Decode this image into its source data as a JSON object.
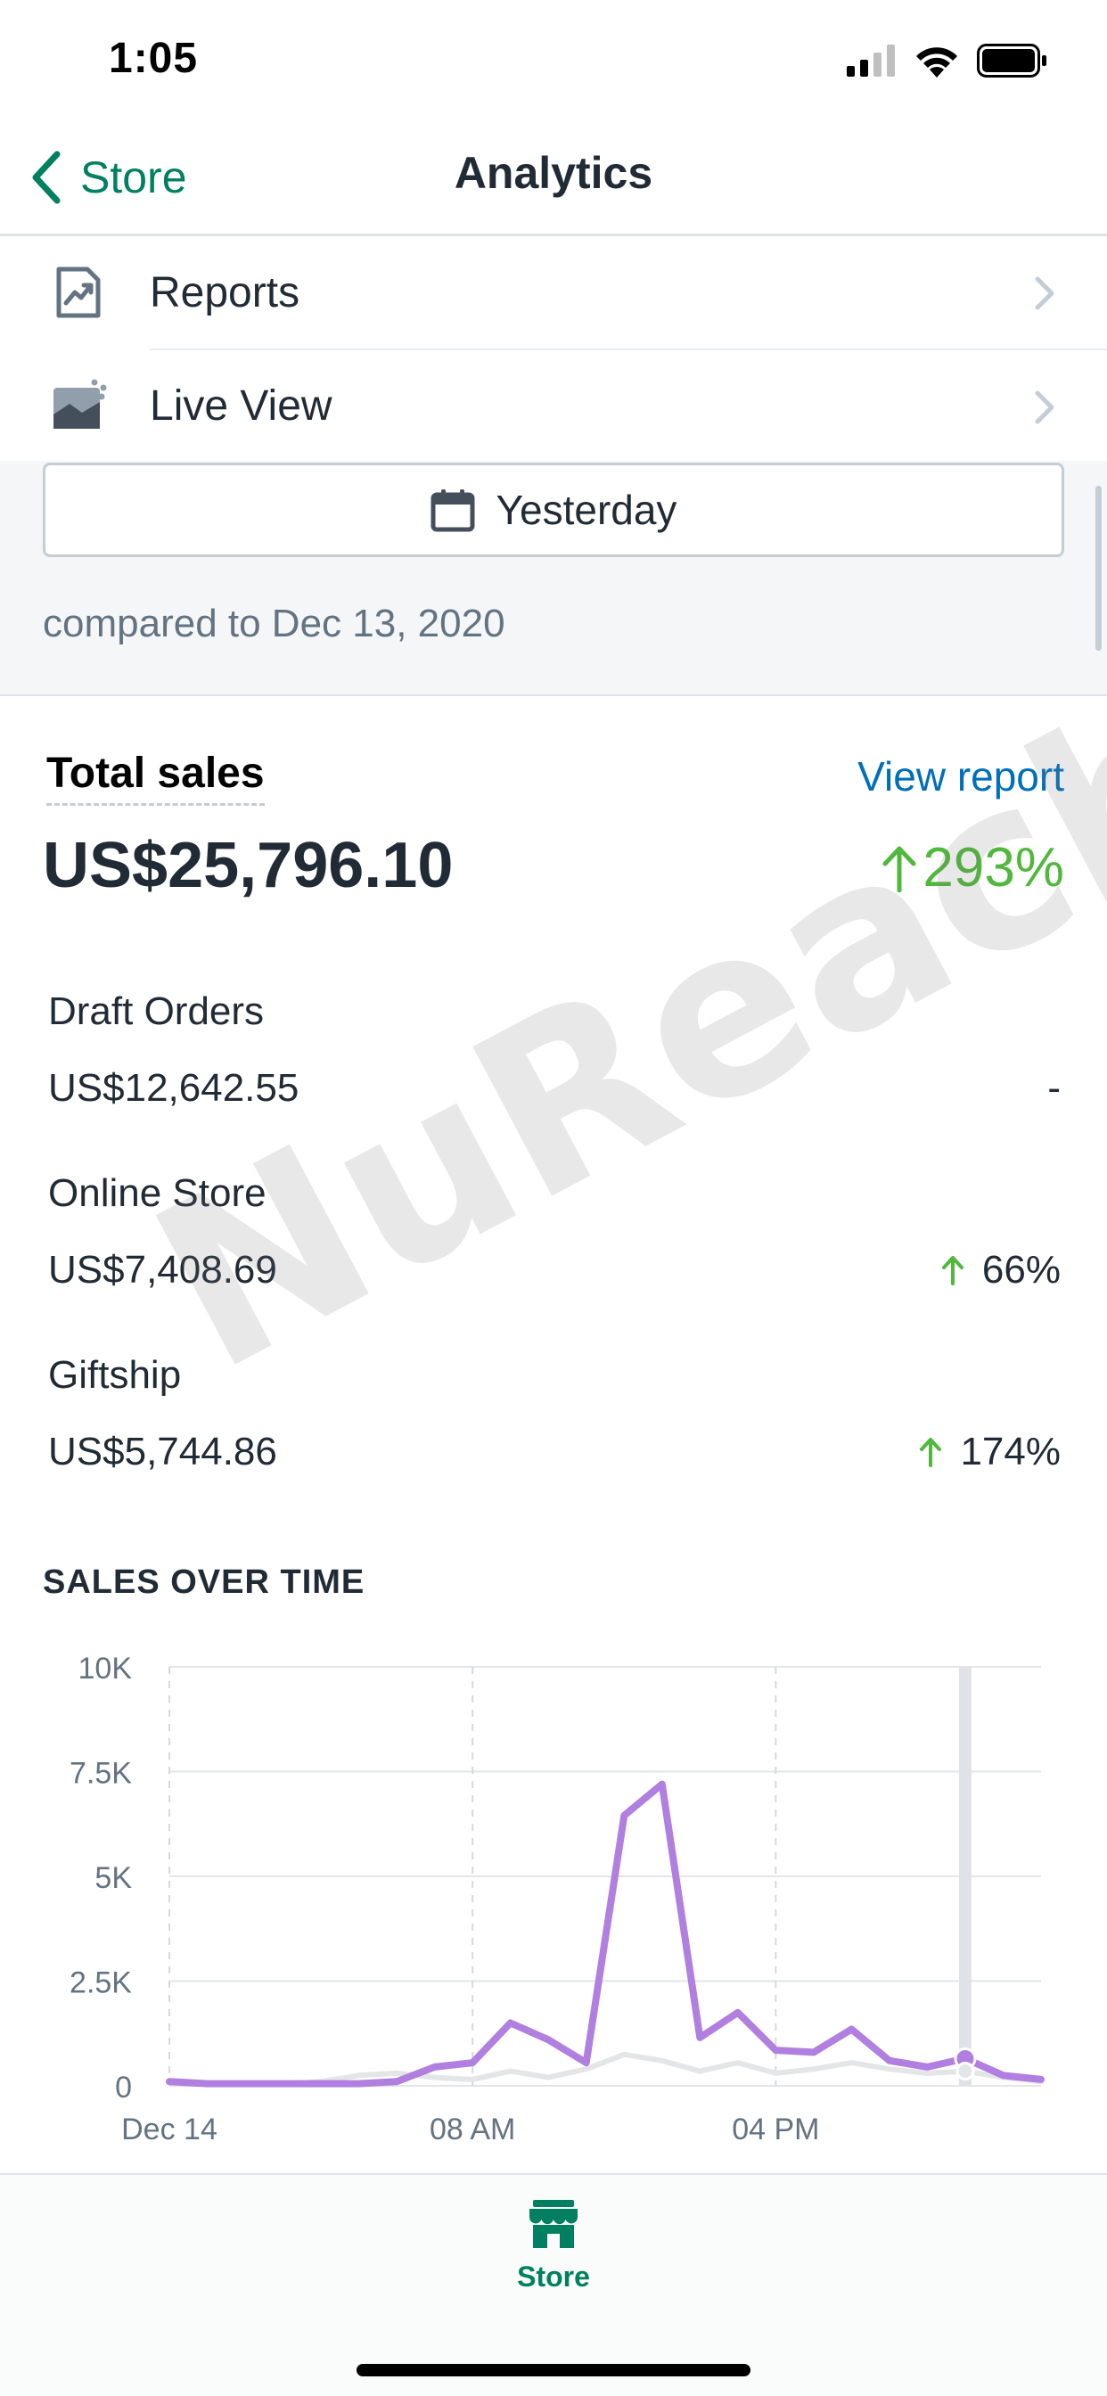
{
  "status_bar": {
    "time": "1:05"
  },
  "nav": {
    "back_label": "Store",
    "title": "Analytics"
  },
  "menu": [
    {
      "label": "Reports",
      "icon": "reports-icon"
    },
    {
      "label": "Live View",
      "icon": "live-view-icon"
    }
  ],
  "date_range": {
    "label": "Yesterday",
    "compare": "compared to Dec 13, 2020"
  },
  "total_sales": {
    "label": "Total sales",
    "view_report": "View report",
    "value": "US$25,796.10",
    "change": "293%"
  },
  "channels": [
    {
      "name": "Draft Orders",
      "value": "US$12,642.55",
      "change": "-",
      "trend": "none"
    },
    {
      "name": "Online Store",
      "value": "US$7,408.69",
      "change": "66%",
      "trend": "up"
    },
    {
      "name": "Giftship",
      "value": "US$5,744.86",
      "change": "174%",
      "trend": "up"
    }
  ],
  "watermark": "NuReach",
  "chart_heading": "SALES OVER TIME",
  "chart_data": {
    "type": "line",
    "title": "SALES OVER TIME",
    "xlabel": "",
    "ylabel": "",
    "x": [
      0,
      1,
      2,
      3,
      4,
      5,
      6,
      7,
      8,
      9,
      10,
      11,
      12,
      13,
      14,
      15,
      16,
      17,
      18,
      19,
      20,
      21,
      22,
      23
    ],
    "x_tick_labels": [
      {
        "x": 0,
        "label": "Dec 14"
      },
      {
        "x": 8,
        "label": "08 AM"
      },
      {
        "x": 16,
        "label": "04 PM"
      }
    ],
    "y_tick_labels": [
      "0",
      "2.5K",
      "5K",
      "7.5K",
      "10K"
    ],
    "y_ticks": [
      0,
      2500,
      5000,
      7500,
      10000
    ],
    "ylim": [
      0,
      10000
    ],
    "grid": true,
    "highlight_x": 21,
    "series": [
      {
        "color": "#b07fe0",
        "values": [
          100,
          50,
          50,
          50,
          50,
          50,
          100,
          450,
          550,
          1500,
          1100,
          550,
          6450,
          7200,
          1150,
          1750,
          850,
          800,
          1350,
          600,
          450,
          650,
          250,
          150
        ]
      },
      {
        "color": "#e4e5e7",
        "values": [
          80,
          40,
          40,
          40,
          100,
          250,
          300,
          200,
          150,
          350,
          200,
          400,
          750,
          600,
          350,
          550,
          300,
          400,
          550,
          400,
          300,
          350,
          200,
          100
        ]
      }
    ]
  },
  "tab_bar": {
    "store_label": "Store"
  },
  "colors": {
    "accent": "#008060",
    "link": "#006fbb",
    "positive": "#50b83c"
  }
}
